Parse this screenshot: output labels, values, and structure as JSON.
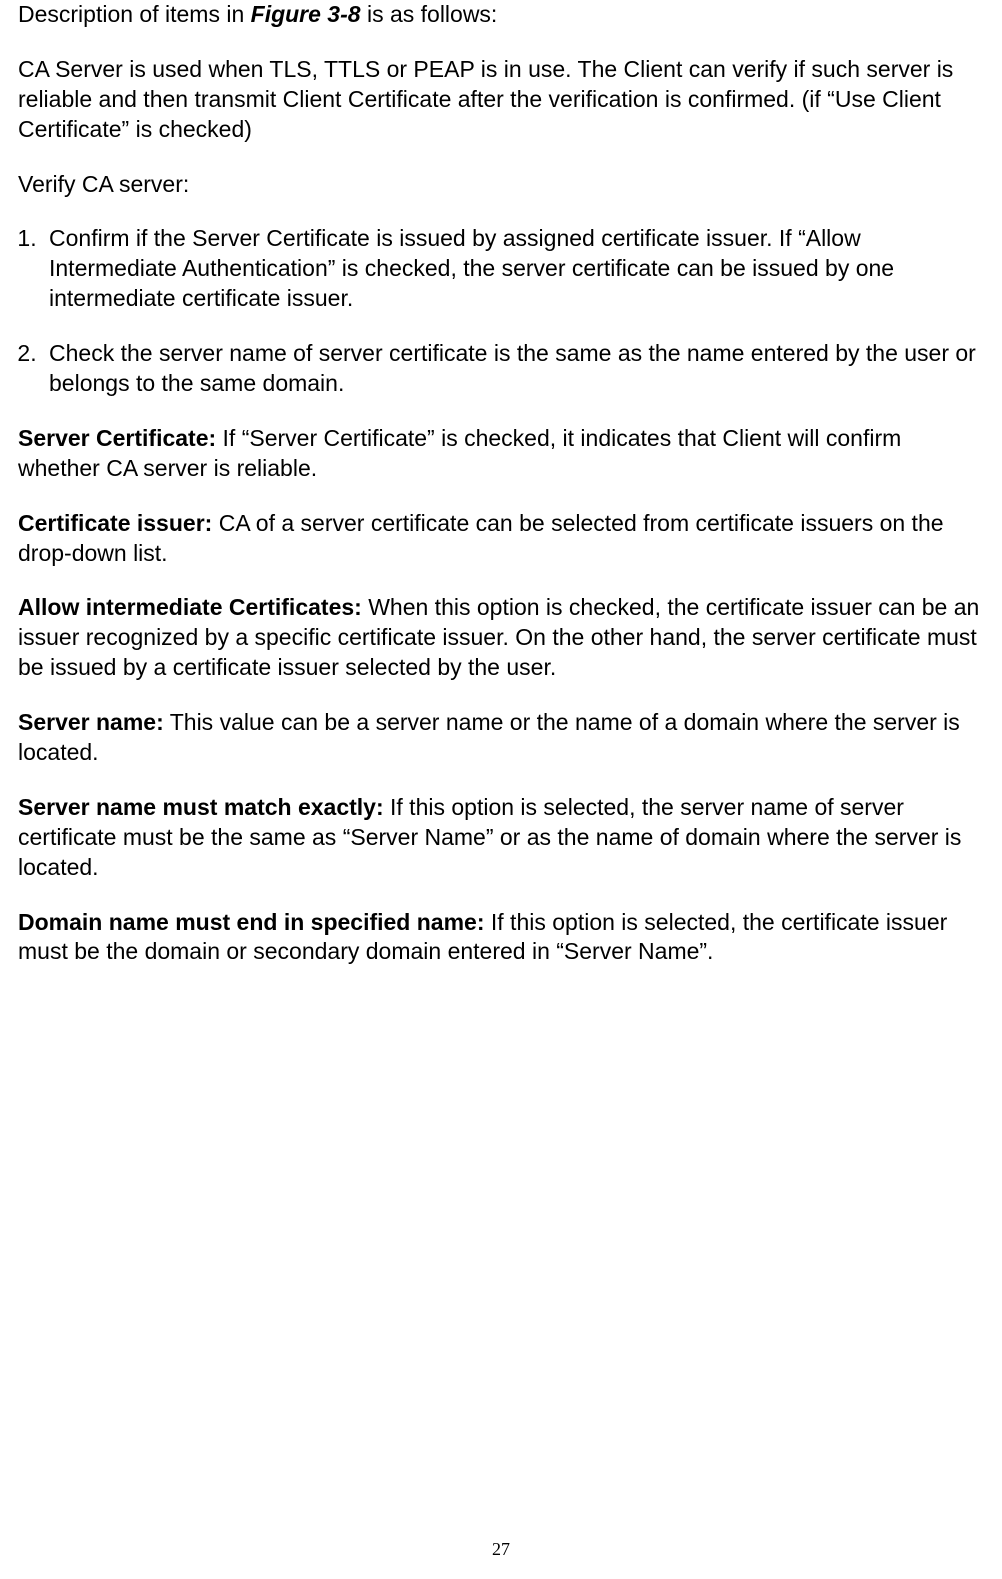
{
  "intro": {
    "part1": "Description of items in ",
    "figure_ref": "Figure 3-8",
    "part2": " is as follows:"
  },
  "ca_server_para": "CA Server is used when TLS, TTLS or PEAP is in use. The Client can verify if such server is reliable and then transmit Client Certificate after the verification is confirmed. (if “Use Client Certificate” is checked)",
  "verify_heading": "Verify CA server:",
  "verify_list": {
    "item1": "Confirm if the Server Certificate is issued by assigned certificate issuer. If “Allow Intermediate Authentication” is checked, the server certificate can be issued by one intermediate certificate issuer.",
    "item2": "Check the server name of server certificate is the same as the name entered by the user or belongs to the same domain."
  },
  "defs": {
    "server_certificate": {
      "term": "Server Certificate:",
      "desc": " If “Server Certificate” is checked, it indicates that Client will confirm whether CA server is reliable."
    },
    "certificate_issuer": {
      "term": "Certificate issuer:",
      "desc": " CA of a server certificate can be selected from certificate issuers on the drop-down list."
    },
    "allow_intermediate": {
      "term": "Allow intermediate Certificates:",
      "desc": " When this option is checked, the certificate issuer can be an issuer recognized by a specific certificate issuer. On the other hand, the server certificate must be issued by a certificate issuer selected by the user."
    },
    "server_name": {
      "term": "Server name:",
      "desc": " This value can be a server name or the name of a domain where the server is located."
    },
    "match_exactly": {
      "term": "Server name must match exactly:",
      "desc": " If this option is selected, the server name of server certificate must be the same as “Server Name” or as the name of domain where the server is located."
    },
    "domain_end": {
      "term": "Domain name must end in specified name:",
      "desc": " If this option is selected, the certificate issuer must be the domain or secondary domain entered in “Server Name”."
    }
  },
  "page_number": "27"
}
